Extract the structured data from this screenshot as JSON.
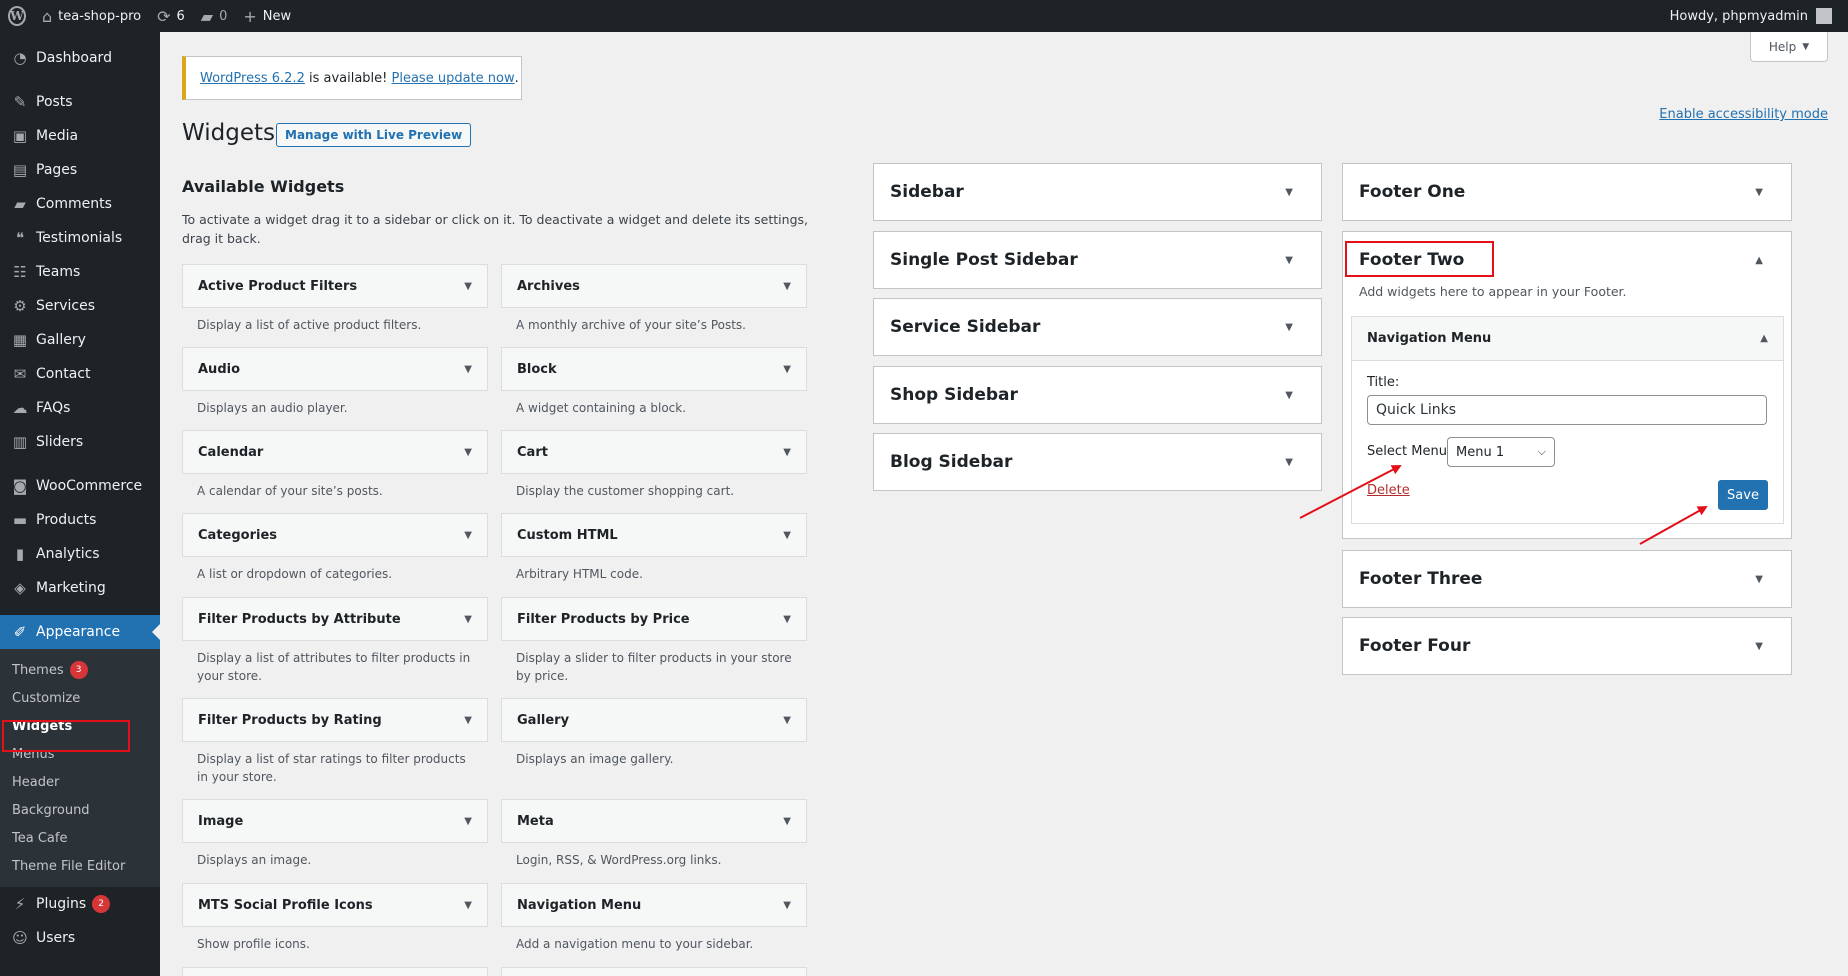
{
  "adminbar": {
    "site_name": "tea-shop-pro",
    "updates_count": "6",
    "comments_count": "0",
    "new_label": "New",
    "howdy": "Howdy, phpmyadmin"
  },
  "sidebar": {
    "items": [
      {
        "label": "Dashboard",
        "icon": "dashboard-icon"
      },
      {
        "label": "Posts",
        "icon": "pin-icon"
      },
      {
        "label": "Media",
        "icon": "media-icon"
      },
      {
        "label": "Pages",
        "icon": "page-icon"
      },
      {
        "label": "Comments",
        "icon": "comment-icon"
      },
      {
        "label": "Testimonials",
        "icon": "testimonial-icon"
      },
      {
        "label": "Teams",
        "icon": "group-icon"
      },
      {
        "label": "Services",
        "icon": "gear-icon"
      },
      {
        "label": "Gallery",
        "icon": "gallery-icon"
      },
      {
        "label": "Contact",
        "icon": "email-icon"
      },
      {
        "label": "FAQs",
        "icon": "faq-icon"
      },
      {
        "label": "Sliders",
        "icon": "slider-icon"
      },
      {
        "label": "WooCommerce",
        "icon": "woo-icon"
      },
      {
        "label": "Products",
        "icon": "archive-icon"
      },
      {
        "label": "Analytics",
        "icon": "chart-icon"
      },
      {
        "label": "Marketing",
        "icon": "megaphone-icon"
      },
      {
        "label": "Appearance",
        "icon": "brush-icon"
      },
      {
        "label": "Plugins",
        "icon": "plugin-icon",
        "badge": "2"
      },
      {
        "label": "Users",
        "icon": "user-icon"
      }
    ],
    "submenu": [
      {
        "label": "Themes",
        "badge": "3"
      },
      {
        "label": "Customize"
      },
      {
        "label": "Widgets"
      },
      {
        "label": "Menus"
      },
      {
        "label": "Header"
      },
      {
        "label": "Background"
      },
      {
        "label": "Tea Cafe"
      },
      {
        "label": "Theme File Editor"
      }
    ]
  },
  "notice": {
    "link1": "WordPress 6.2.2",
    "middle": " is available! ",
    "link2": "Please update now",
    "end": "."
  },
  "help_label": "Help",
  "accessibility_link": "Enable accessibility mode",
  "page_title": "Widgets",
  "live_preview_button": "Manage with Live Preview",
  "available": {
    "title": "Available Widgets",
    "description": "To activate a widget drag it to a sidebar or click on it. To deactivate a widget and delete its settings, drag it back.",
    "widgets": [
      {
        "name": "Active Product Filters",
        "desc": "Display a list of active product filters."
      },
      {
        "name": "Archives",
        "desc": "A monthly archive of your site’s Posts."
      },
      {
        "name": "Audio",
        "desc": "Displays an audio player."
      },
      {
        "name": "Block",
        "desc": "A widget containing a block."
      },
      {
        "name": "Calendar",
        "desc": "A calendar of your site’s posts."
      },
      {
        "name": "Cart",
        "desc": "Display the customer shopping cart."
      },
      {
        "name": "Categories",
        "desc": "A list or dropdown of categories."
      },
      {
        "name": "Custom HTML",
        "desc": "Arbitrary HTML code."
      },
      {
        "name": "Filter Products by Attribute",
        "desc": "Display a list of attributes to filter products in your store."
      },
      {
        "name": "Filter Products by Price",
        "desc": "Display a slider to filter products in your store by price."
      },
      {
        "name": "Filter Products by Rating",
        "desc": "Display a list of star ratings to filter products in your store."
      },
      {
        "name": "Gallery",
        "desc": "Displays an image gallery."
      },
      {
        "name": "Image",
        "desc": "Displays an image."
      },
      {
        "name": "Meta",
        "desc": "Login, RSS, & WordPress.org links."
      },
      {
        "name": "MTS Social Profile Icons",
        "desc": "Show profile icons."
      },
      {
        "name": "Navigation Menu",
        "desc": "Add a navigation menu to your sidebar."
      }
    ]
  },
  "sidebars_left": [
    "Sidebar",
    "Single Post Sidebar",
    "Service Sidebar",
    "Shop Sidebar",
    "Blog Sidebar"
  ],
  "sidebars_right": {
    "footer_one": "Footer One",
    "footer_two": {
      "title": "Footer Two",
      "description": "Add widgets here to appear in your Footer.",
      "widget": {
        "name": "Navigation Menu",
        "title_label": "Title:",
        "title_value": "Quick Links",
        "select_label": "Select Menu:",
        "select_value": "Menu 1",
        "delete_label": "Delete",
        "save_label": "Save"
      }
    },
    "footer_three": "Footer Three",
    "footer_four": "Footer Four"
  },
  "colors": {
    "accent": "#2271b1",
    "admin_dark": "#1d2327",
    "annotation_red": "#e3101a",
    "notice_warning": "#dba617"
  }
}
